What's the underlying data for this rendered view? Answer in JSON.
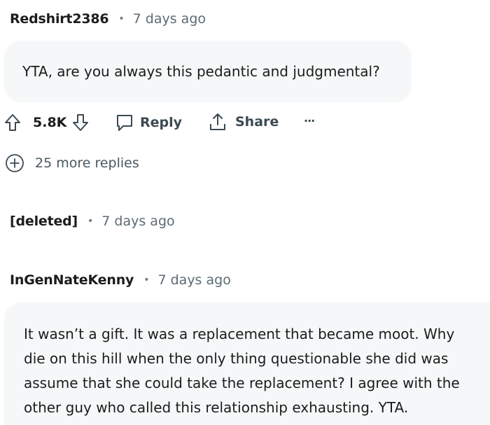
{
  "comments": [
    {
      "author": "Redshirt2386",
      "separator": "•",
      "time": "7 days ago",
      "body": "YTA, are you always this pedantic and judgmental?",
      "score": "5.8K",
      "reply_label": "Reply",
      "share_label": "Share",
      "overflow_label": "···",
      "more_replies": "25 more replies"
    },
    {
      "author": "[deleted]",
      "separator": "•",
      "time": "7 days ago"
    },
    {
      "author": "InGenNateKenny",
      "separator": "•",
      "time": "7 days ago",
      "body_lines": [
        "It wasn’t a gift. It was a replacement that became moot. Why",
        "die on this hill when the only thing questionable she did was",
        "assume that she could take the replacement? I agree with the",
        "other guy who called this relationship exhausting. YTA."
      ]
    }
  ],
  "icons": [
    "upvote-icon",
    "downvote-icon",
    "reply-icon",
    "share-icon",
    "more-options-icon",
    "expand-replies-icon"
  ],
  "colors": {
    "bubble_bg": "#f5f7f8",
    "meta_text": "#5c6b73",
    "action_text": "#3c4a52"
  }
}
